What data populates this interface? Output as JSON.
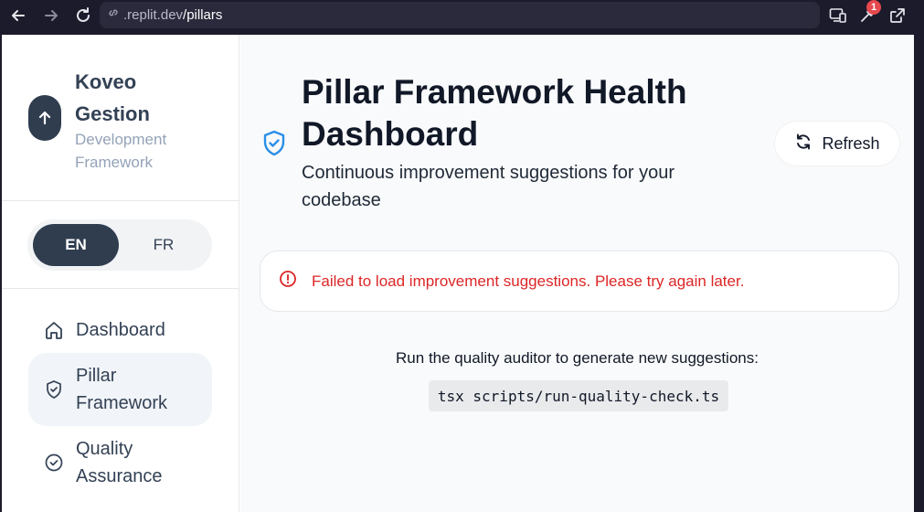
{
  "browser": {
    "url_prefix": ".replit.dev",
    "url_path": "/pillars",
    "notification_count": "1"
  },
  "sidebar": {
    "brand_name": "Koveo Gestion",
    "brand_subtitle": "Development Framework",
    "lang": {
      "en": "EN",
      "fr": "FR",
      "active": "EN"
    },
    "items": [
      {
        "label": "Dashboard",
        "icon": "home-icon",
        "active": false
      },
      {
        "label": "Pillar Framework",
        "icon": "shield-check-icon",
        "active": true
      },
      {
        "label": "Quality Assurance",
        "icon": "check-circle-icon",
        "active": false
      }
    ]
  },
  "main": {
    "title": "Pillar Framework Health Dashboard",
    "subtitle": "Continuous improvement suggestions for your codebase",
    "refresh_label": "Refresh",
    "error_message": "Failed to load improvement suggestions. Please try again later.",
    "hint": "Run the quality auditor to generate new suggestions:",
    "command": "tsx scripts/run-quality-check.ts"
  },
  "colors": {
    "accent_blue": "#2b8fe8",
    "error_red": "#dc2626",
    "dark_slate": "#2f3d4f"
  }
}
